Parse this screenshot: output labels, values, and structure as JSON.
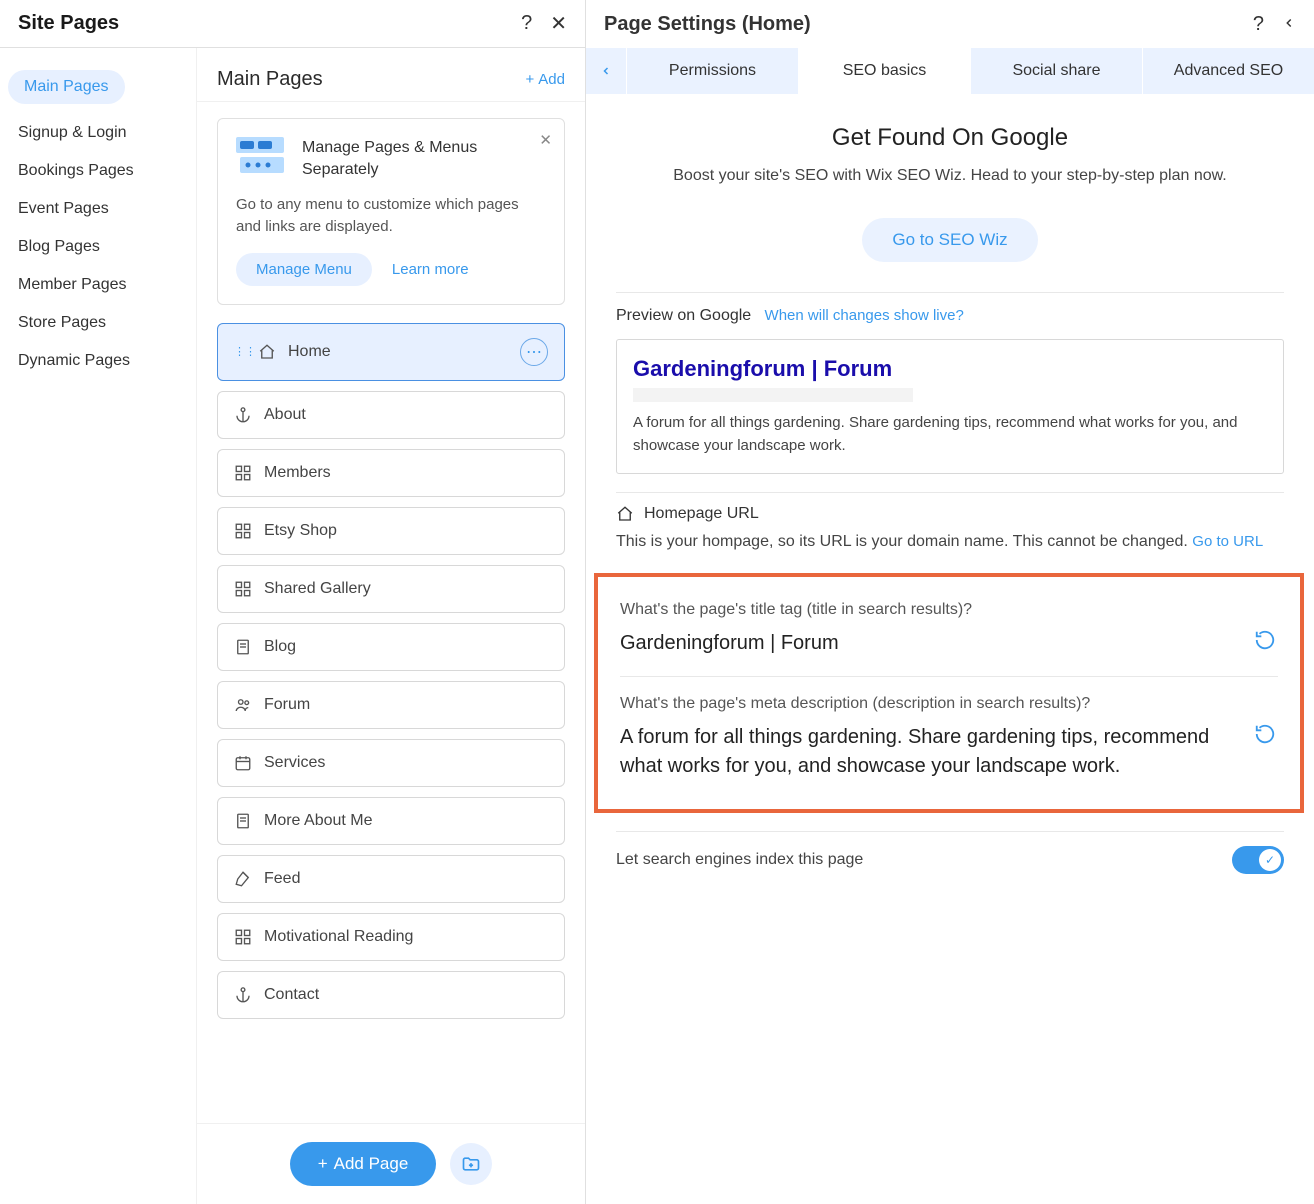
{
  "leftPanel": {
    "title": "Site Pages",
    "categories": [
      {
        "label": "Main Pages",
        "active": true
      },
      {
        "label": "Signup & Login"
      },
      {
        "label": "Bookings Pages"
      },
      {
        "label": "Event Pages"
      },
      {
        "label": "Blog Pages"
      },
      {
        "label": "Member Pages"
      },
      {
        "label": "Store Pages"
      },
      {
        "label": "Dynamic Pages"
      }
    ],
    "main": {
      "heading": "Main Pages",
      "addLabel": "Add",
      "info": {
        "heading": "Manage Pages & Menus Separately",
        "desc": "Go to any menu to customize which pages and links are displayed.",
        "manageBtn": "Manage Menu",
        "learnMore": "Learn more"
      },
      "pages": [
        {
          "label": "Home",
          "icon": "home",
          "active": true
        },
        {
          "label": "About",
          "icon": "anchor"
        },
        {
          "label": "Members",
          "icon": "grid"
        },
        {
          "label": "Etsy Shop",
          "icon": "grid"
        },
        {
          "label": "Shared Gallery",
          "icon": "grid"
        },
        {
          "label": "Blog",
          "icon": "page"
        },
        {
          "label": "Forum",
          "icon": "people"
        },
        {
          "label": "Services",
          "icon": "calendar"
        },
        {
          "label": "More About Me",
          "icon": "page"
        },
        {
          "label": "Feed",
          "icon": "pen"
        },
        {
          "label": "Motivational Reading",
          "icon": "grid"
        },
        {
          "label": "Contact",
          "icon": "anchor"
        }
      ],
      "addPageBtn": "Add Page"
    }
  },
  "rightPanel": {
    "title": "Page Settings (Home)",
    "tabs": [
      {
        "label": "Permissions"
      },
      {
        "label": "SEO basics",
        "active": true
      },
      {
        "label": "Social share"
      },
      {
        "label": "Advanced SEO"
      }
    ],
    "hero": {
      "title": "Get Found On Google",
      "desc": "Boost your site's SEO with Wix SEO Wiz. Head to your step-by-step plan now.",
      "btn": "Go to SEO Wiz"
    },
    "preview": {
      "label": "Preview on Google",
      "link": "When will changes show live?",
      "title": "Gardeningforum | Forum",
      "desc": "A forum for all things gardening. Share gardening tips, recommend what works for you, and showcase your landscape work."
    },
    "homepageUrl": {
      "heading": "Homepage URL",
      "text": "This is your hompage, so its URL is your domain name. This cannot be changed. ",
      "link": "Go to URL"
    },
    "titleField": {
      "label": "What's the page's title tag (title in search results)?",
      "value": "Gardeningforum | Forum"
    },
    "descField": {
      "label": "What's the page's meta description (description in search results)?",
      "value": "A forum for all things gardening. Share gardening tips, recommend what works for you, and showcase your landscape work."
    },
    "indexToggle": {
      "label": "Let search engines index this page",
      "on": true
    }
  }
}
